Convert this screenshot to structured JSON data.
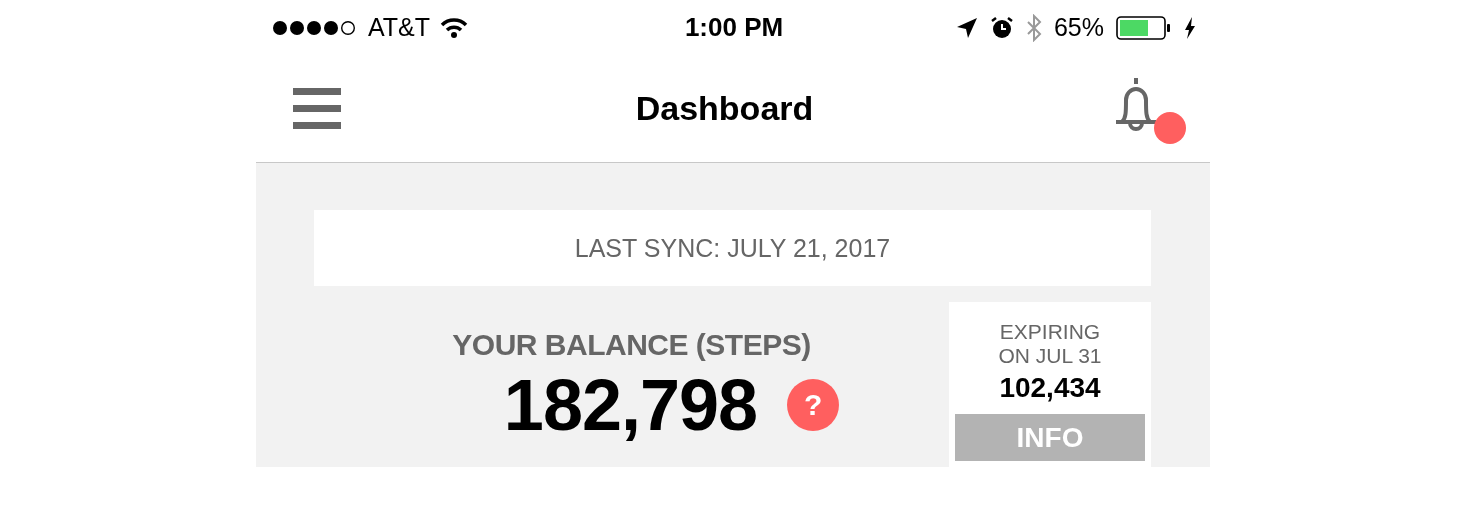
{
  "status_bar": {
    "carrier": "AT&T",
    "time": "1:00 PM",
    "battery_percent": "65%",
    "charging": true
  },
  "nav_bar": {
    "title": "Dashboard",
    "notifications_unread": true
  },
  "sync": {
    "text": "LAST SYNC: JULY 21, 2017"
  },
  "balance": {
    "label": "YOUR BALANCE (STEPS)",
    "value": "182,798",
    "help": "?"
  },
  "expiring": {
    "label_lines": [
      "EXPIRING",
      "ON JUL 31"
    ],
    "value": "102,434",
    "button": "INFO"
  }
}
